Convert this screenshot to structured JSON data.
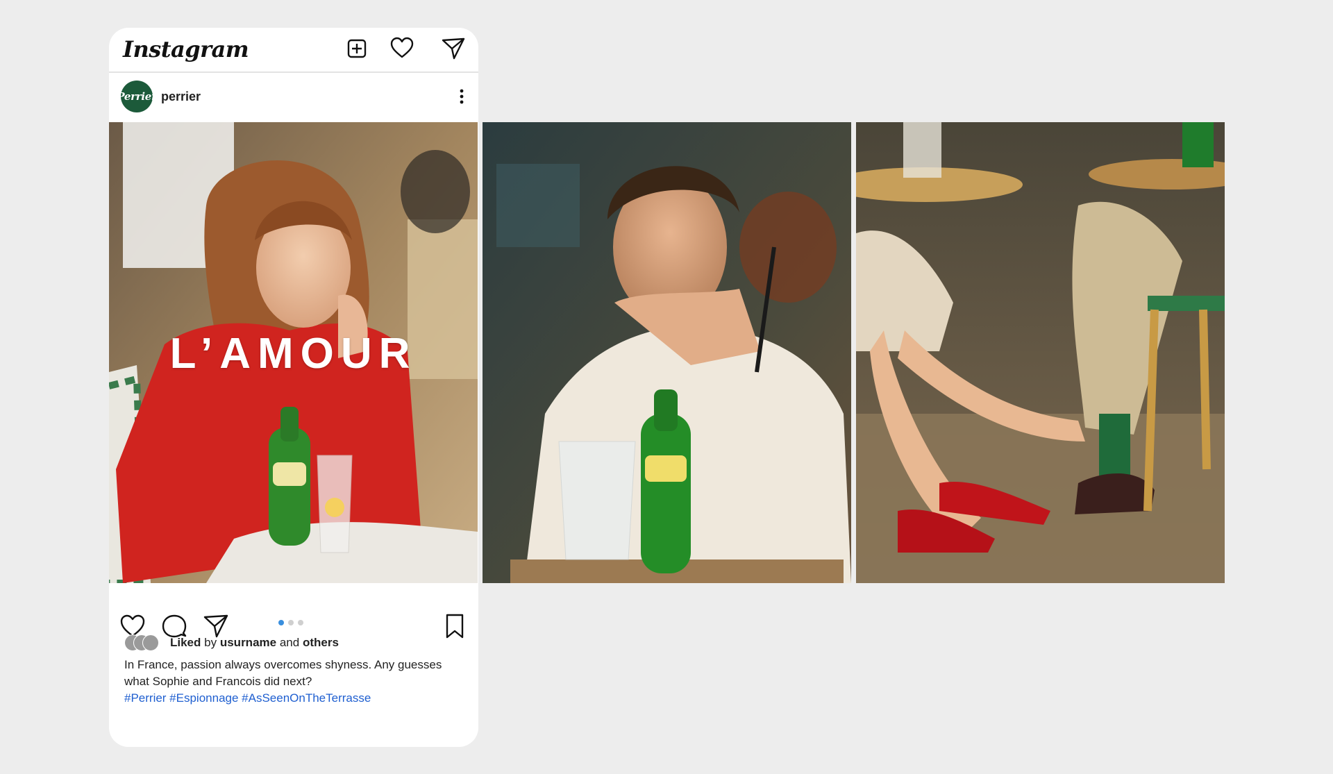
{
  "app": {
    "logo_text": "Instagram",
    "top_icons": [
      "new-post-icon",
      "heart-icon",
      "direct-message-icon"
    ]
  },
  "post": {
    "username": "perrier",
    "avatar_text": "Perrier",
    "overlay_text": "L’AMOUR",
    "carousel": {
      "total": 3,
      "active_index": 0
    },
    "liked": {
      "prefix": "Liked",
      "by": "by",
      "user": "usurname",
      "and": "and",
      "others": "others"
    },
    "caption": "In France, passion always overcomes shyness. Any guesses what Sophie and Francois did next?",
    "hashtags": "#Perrier #Espionnage #AsSeenOnTheTerrasse"
  },
  "colors": {
    "background": "#ededed",
    "link": "#1f5fd0",
    "carousel_active": "#3a8fde",
    "brand_green": "#1c5a3a"
  }
}
